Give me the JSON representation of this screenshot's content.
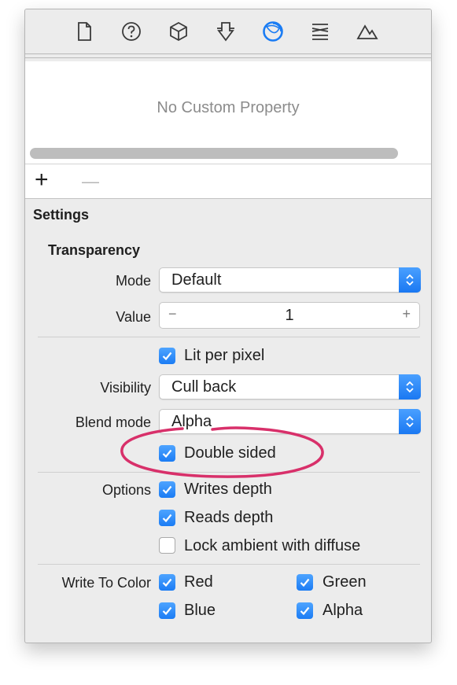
{
  "toolbar": {
    "icons": [
      "file-icon",
      "help-icon",
      "cube-icon",
      "attributes-icon",
      "material-icon",
      "scene-icon",
      "mountain-icon"
    ],
    "active_icon": "material-icon"
  },
  "custom_property": {
    "empty_text": "No Custom Property"
  },
  "plus_minus": {
    "plus": "+",
    "minus": "—"
  },
  "settings": {
    "title": "Settings",
    "transparency": {
      "title": "Transparency",
      "mode_label": "Mode",
      "mode_value": "Default",
      "value_label": "Value",
      "value": "1",
      "minus": "−",
      "plus": "+"
    },
    "lit_per_pixel": {
      "label": "Lit per pixel",
      "checked": true
    },
    "visibility": {
      "label": "Visibility",
      "value": "Cull back"
    },
    "blend_mode": {
      "label": "Blend mode",
      "value": "Alpha"
    },
    "double_sided": {
      "label": "Double sided",
      "checked": true
    },
    "options": {
      "label": "Options",
      "writes_depth": {
        "label": "Writes depth",
        "checked": true
      },
      "reads_depth": {
        "label": "Reads depth",
        "checked": true
      },
      "lock_ambient": {
        "label": "Lock ambient with diffuse",
        "checked": false
      }
    },
    "write_to_color": {
      "label": "Write To Color",
      "red": {
        "label": "Red",
        "checked": true
      },
      "green": {
        "label": "Green",
        "checked": true
      },
      "blue": {
        "label": "Blue",
        "checked": true
      },
      "alpha": {
        "label": "Alpha",
        "checked": true
      }
    }
  },
  "colors": {
    "accent": "#1a7cf4",
    "annotation": "#d8306a"
  }
}
